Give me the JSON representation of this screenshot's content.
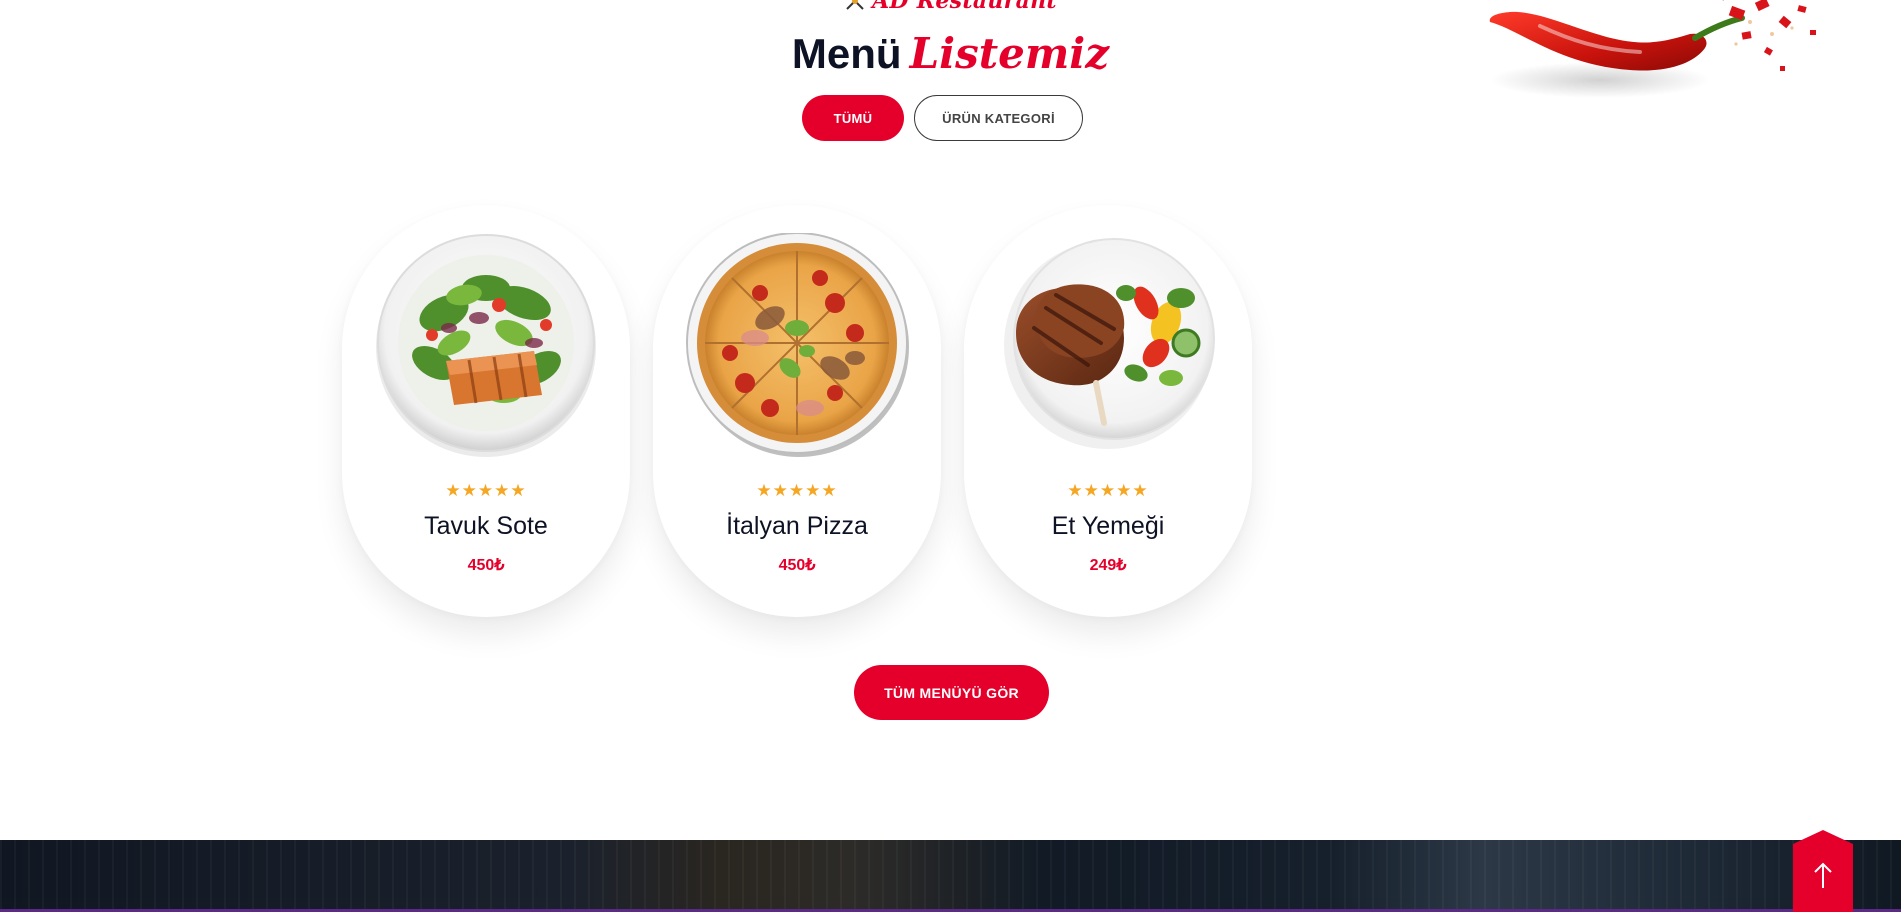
{
  "brand": {
    "name": "AD Restaurant",
    "icon": "crossed-utensils-icon"
  },
  "section": {
    "title_part1": "Menü",
    "title_part2": "Listemiz"
  },
  "tabs": [
    {
      "label": "TÜMÜ",
      "active": true
    },
    {
      "label": "ÜRÜN KATEGORİ",
      "active": false
    }
  ],
  "menu_items": [
    {
      "name": "Tavuk Sote",
      "price": "450₺",
      "rating": "★★★★★",
      "image": "salad-plate-image"
    },
    {
      "name": "İtalyan Pizza",
      "price": "450₺",
      "rating": "★★★★★",
      "image": "pizza-image"
    },
    {
      "name": "Et Yemeği",
      "price": "249₺",
      "rating": "★★★★★",
      "image": "steak-plate-image"
    }
  ],
  "cta": {
    "label": "TÜM MENÜYÜ GÖR"
  },
  "back_to_top": {
    "icon": "arrow-up-icon"
  },
  "colors": {
    "accent": "#e4002b",
    "dark_text": "#0d1224",
    "star": "#f5a623"
  }
}
